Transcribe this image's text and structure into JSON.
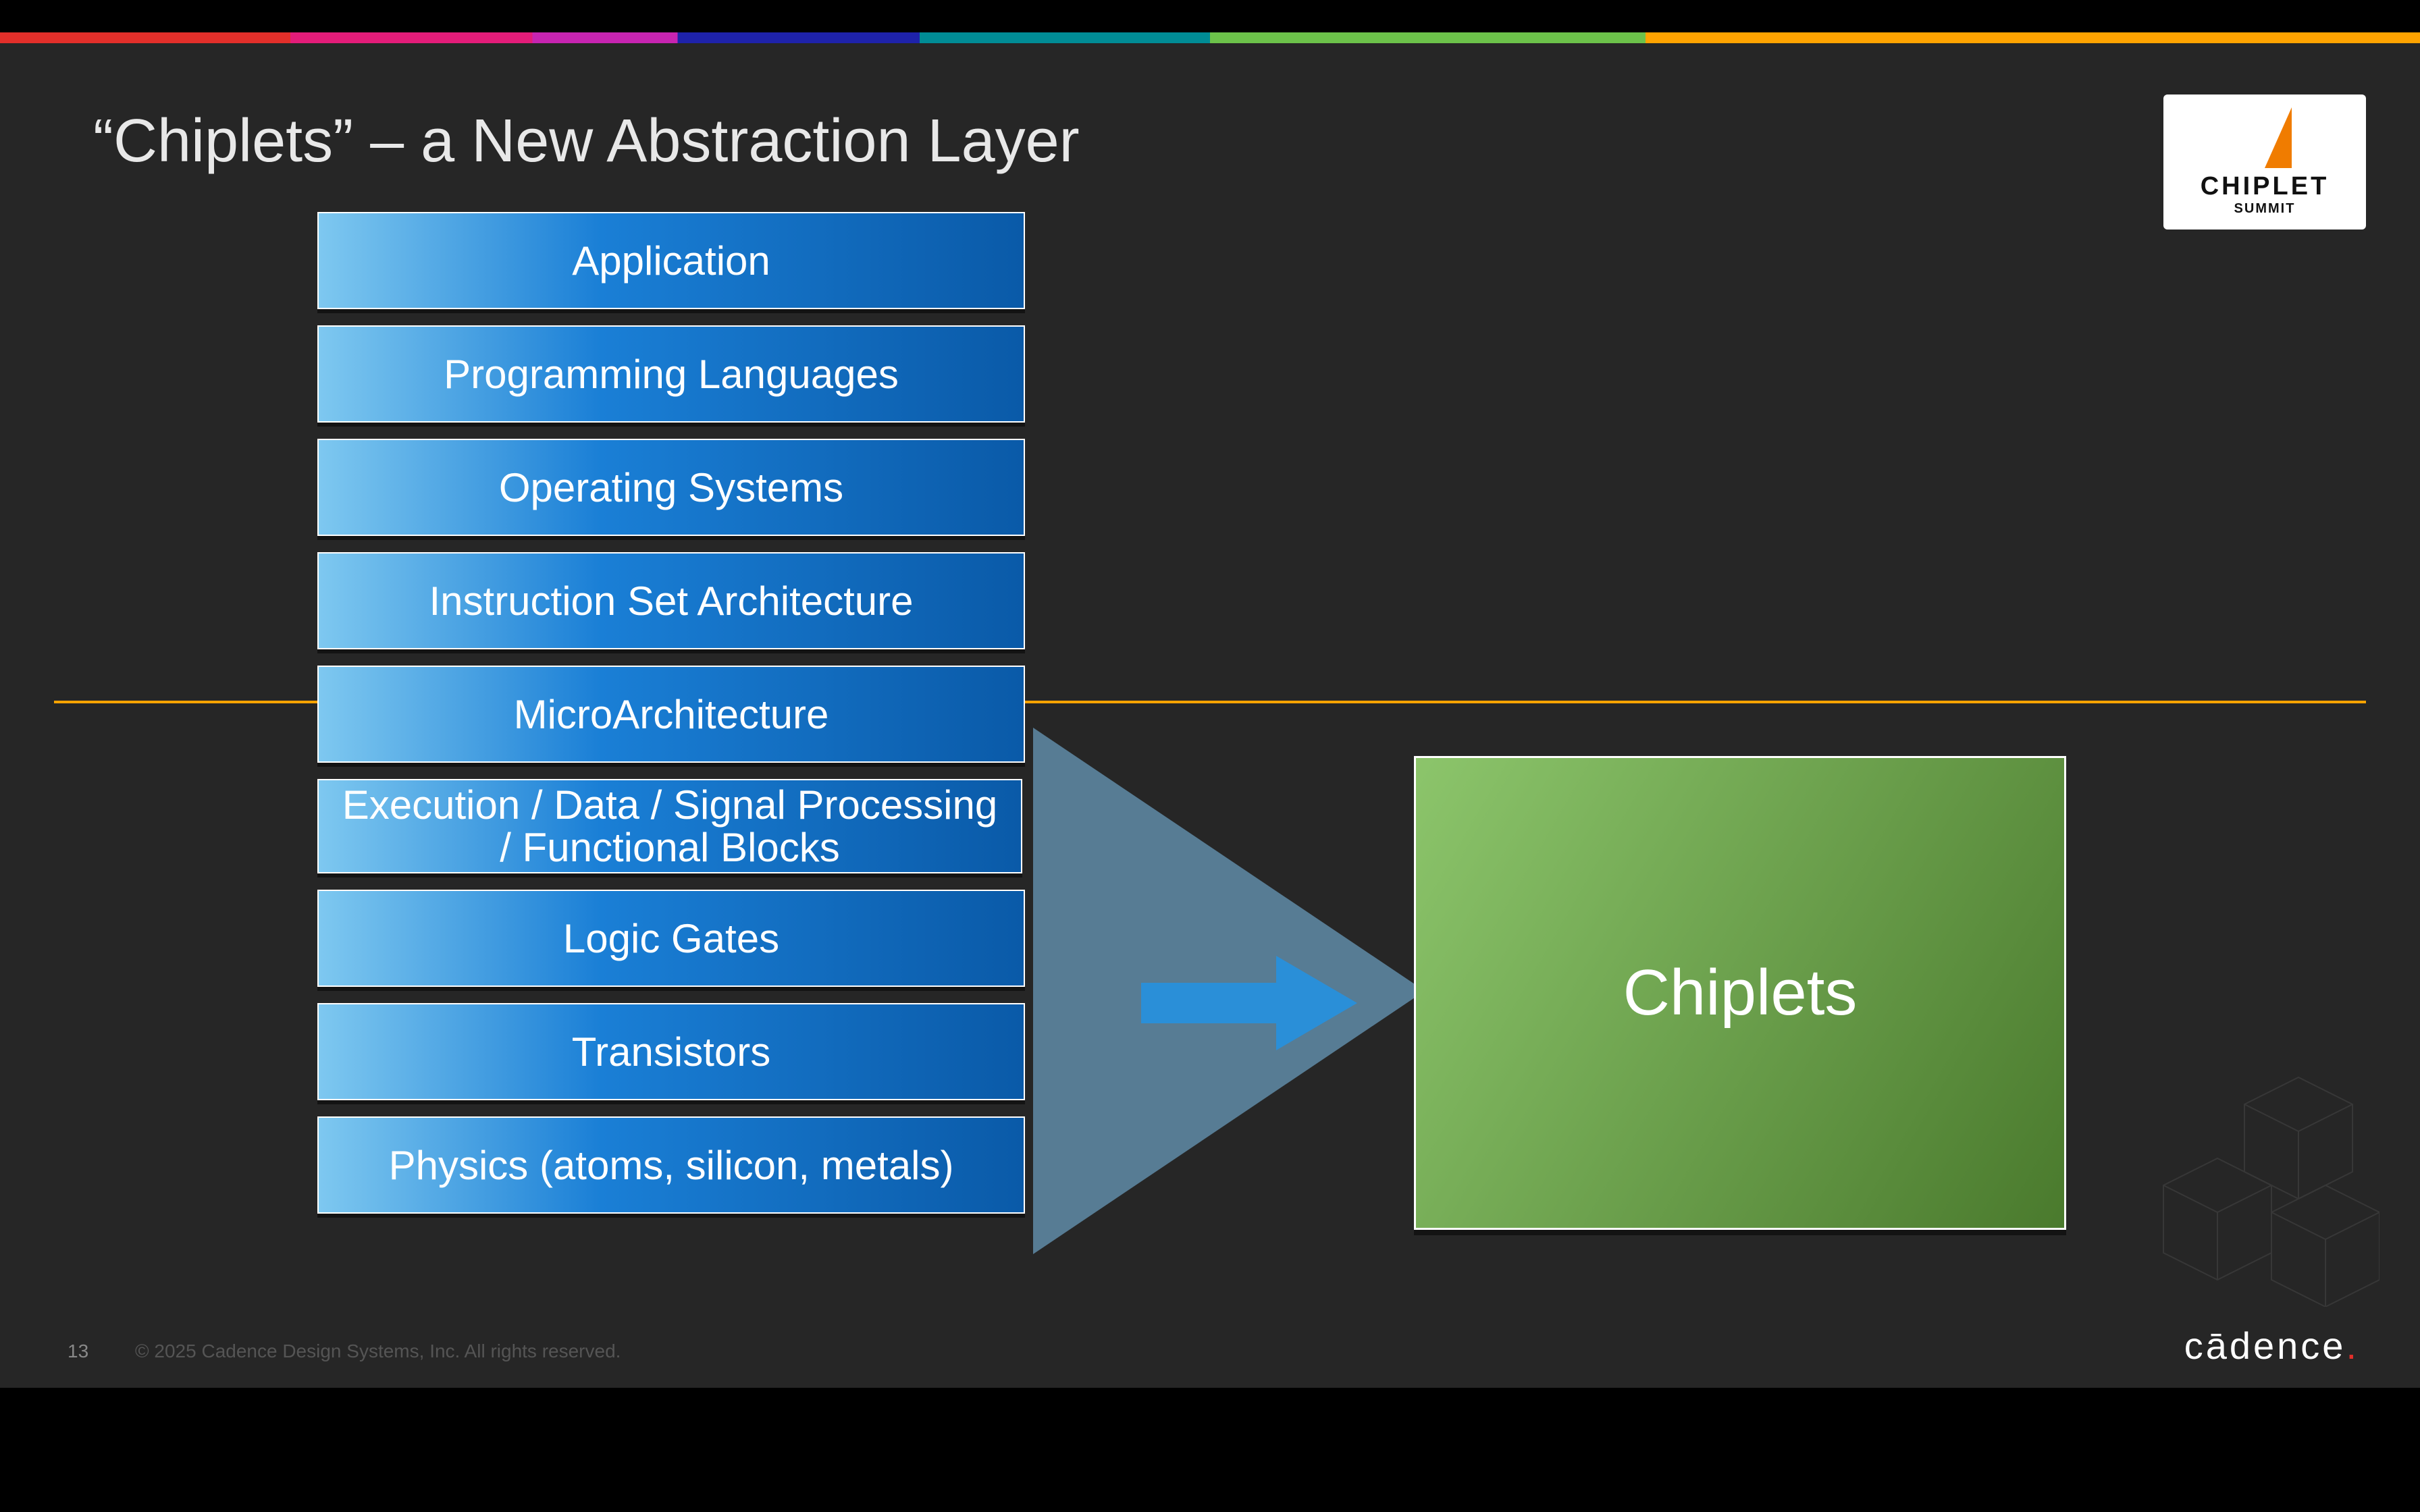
{
  "title": "“Chiplets” – a New Abstraction Layer",
  "summit_logo": {
    "line1": "CHIPLET",
    "line2": "SUMMIT"
  },
  "layers": [
    "Application",
    "Programming Languages",
    "Operating Systems",
    "Instruction Set Architecture",
    "MicroArchitecture",
    "Execution / Data / Signal Processing / Functional Blocks",
    "Logic Gates",
    "Transistors",
    "Physics (atoms, silicon, metals)"
  ],
  "target_box": "Chiplets",
  "footer": {
    "page": "13",
    "copyright": "© 2025 Cadence Design Systems, Inc. All rights reserved.",
    "brand": "cādence"
  },
  "colors": {
    "accent_orange": "#ffa300",
    "layer_blue_a": "#7ec8f0",
    "layer_blue_b": "#0a5aa8",
    "target_green_a": "#8cc56b",
    "target_green_b": "#4a7a2d",
    "arrow_blue": "#2a8fd8"
  }
}
